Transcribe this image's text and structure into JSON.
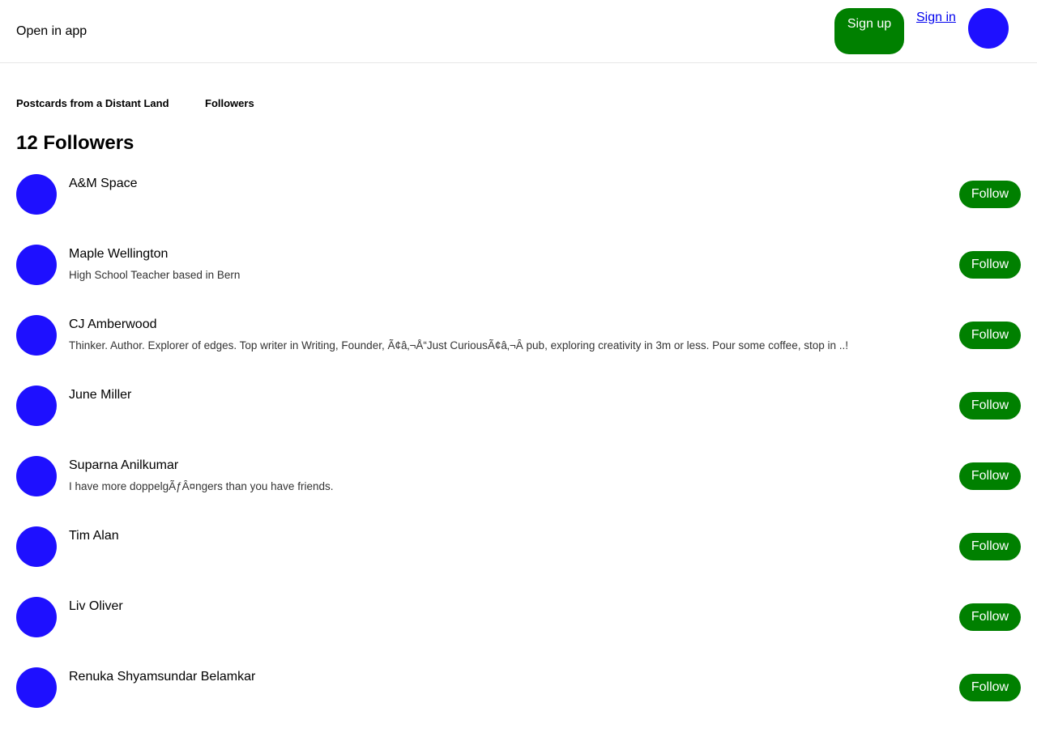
{
  "header": {
    "open_in_app": "Open in app",
    "sign_up": "Sign up",
    "sign_in": "Sign in"
  },
  "breadcrumb": {
    "publication": "Postcards from a Distant Land",
    "current": "Followers"
  },
  "page": {
    "title": "12 Followers"
  },
  "followers": [
    {
      "name": "A&M Space",
      "bio": "",
      "follow_label": "Follow"
    },
    {
      "name": "Maple Wellington",
      "bio": "High School Teacher based in Bern",
      "follow_label": "Follow"
    },
    {
      "name": "CJ Amberwood",
      "bio": "Thinker. Author. Explorer of edges. Top writer in Writing, Founder, Ã¢â‚¬Å“Just CuriousÃ¢â‚¬Â pub, exploring creativity in 3m or less. Pour some coffee, stop in ..!",
      "follow_label": "Follow"
    },
    {
      "name": "June Miller",
      "bio": "",
      "follow_label": "Follow"
    },
    {
      "name": "Suparna Anilkumar",
      "bio": "I have more doppelgÃƒÂ¤ngers than you have friends.",
      "follow_label": "Follow"
    },
    {
      "name": "Tim Alan",
      "bio": "",
      "follow_label": "Follow"
    },
    {
      "name": "Liv Oliver",
      "bio": "",
      "follow_label": "Follow"
    },
    {
      "name": "Renuka Shyamsundar Belamkar",
      "bio": "",
      "follow_label": "Follow"
    }
  ],
  "colors": {
    "accent_green": "#008000",
    "avatar_blue": "#1e10ff",
    "link_blue": "#0000ee"
  }
}
